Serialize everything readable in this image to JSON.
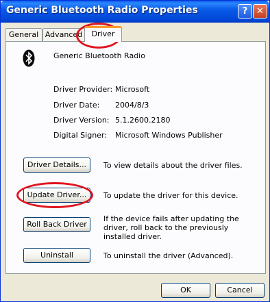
{
  "window": {
    "title": "Generic Bluetooth Radio Properties",
    "help_button": "?",
    "close_button": "✕"
  },
  "tabs": [
    {
      "label": "General"
    },
    {
      "label": "Advanced"
    },
    {
      "label": "Driver"
    }
  ],
  "device": {
    "name": "Generic Bluetooth Radio",
    "icon": "bluetooth-icon"
  },
  "properties": [
    {
      "label": "Driver Provider:",
      "value": "Microsoft"
    },
    {
      "label": "Driver Date:",
      "value": "2004/8/3"
    },
    {
      "label": "Driver Version:",
      "value": "5.1.2600.2180"
    },
    {
      "label": "Digital Signer:",
      "value": "Microsoft Windows Publisher"
    }
  ],
  "actions": [
    {
      "button": "Driver Details...",
      "description": "To view details about the driver files."
    },
    {
      "button": "Update Driver...",
      "description": "To update the driver for this device."
    },
    {
      "button": "Roll Back Driver",
      "description": "If the device fails after updating the driver, roll back to the previously installed driver."
    },
    {
      "button": "Uninstall",
      "description": "To uninstall the driver (Advanced)."
    }
  ],
  "footer": {
    "ok_label": "OK",
    "cancel_label": "Cancel"
  },
  "colors": {
    "titlebar": "#0a5be7",
    "annotation_circle": "#e0141e",
    "active_tab_accent": "#ff9b2a"
  }
}
